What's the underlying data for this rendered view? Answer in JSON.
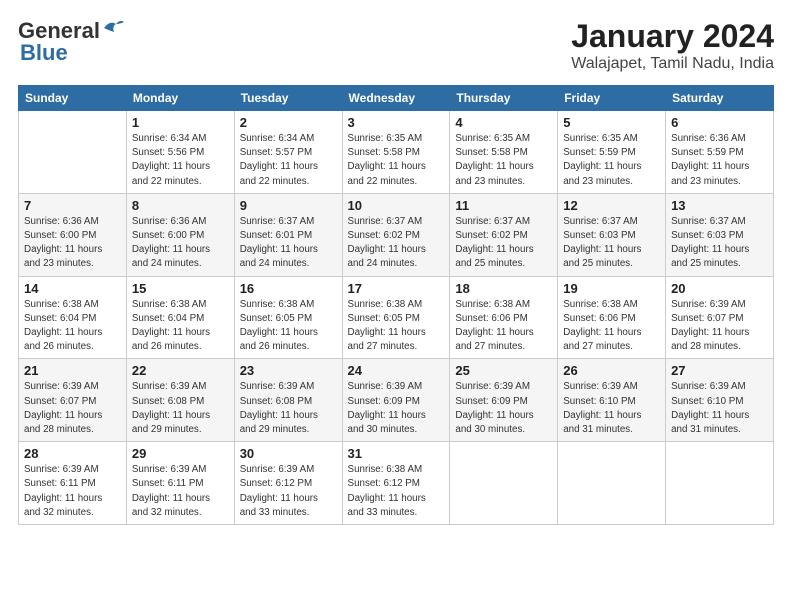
{
  "logo": {
    "line1": "General",
    "line2": "Blue"
  },
  "title": "January 2024",
  "subtitle": "Walajapet, Tamil Nadu, India",
  "days_of_week": [
    "Sunday",
    "Monday",
    "Tuesday",
    "Wednesday",
    "Thursday",
    "Friday",
    "Saturday"
  ],
  "weeks": [
    [
      {
        "num": "",
        "info": ""
      },
      {
        "num": "1",
        "info": "Sunrise: 6:34 AM\nSunset: 5:56 PM\nDaylight: 11 hours\nand 22 minutes."
      },
      {
        "num": "2",
        "info": "Sunrise: 6:34 AM\nSunset: 5:57 PM\nDaylight: 11 hours\nand 22 minutes."
      },
      {
        "num": "3",
        "info": "Sunrise: 6:35 AM\nSunset: 5:58 PM\nDaylight: 11 hours\nand 22 minutes."
      },
      {
        "num": "4",
        "info": "Sunrise: 6:35 AM\nSunset: 5:58 PM\nDaylight: 11 hours\nand 23 minutes."
      },
      {
        "num": "5",
        "info": "Sunrise: 6:35 AM\nSunset: 5:59 PM\nDaylight: 11 hours\nand 23 minutes."
      },
      {
        "num": "6",
        "info": "Sunrise: 6:36 AM\nSunset: 5:59 PM\nDaylight: 11 hours\nand 23 minutes."
      }
    ],
    [
      {
        "num": "7",
        "info": "Sunrise: 6:36 AM\nSunset: 6:00 PM\nDaylight: 11 hours\nand 23 minutes."
      },
      {
        "num": "8",
        "info": "Sunrise: 6:36 AM\nSunset: 6:00 PM\nDaylight: 11 hours\nand 24 minutes."
      },
      {
        "num": "9",
        "info": "Sunrise: 6:37 AM\nSunset: 6:01 PM\nDaylight: 11 hours\nand 24 minutes."
      },
      {
        "num": "10",
        "info": "Sunrise: 6:37 AM\nSunset: 6:02 PM\nDaylight: 11 hours\nand 24 minutes."
      },
      {
        "num": "11",
        "info": "Sunrise: 6:37 AM\nSunset: 6:02 PM\nDaylight: 11 hours\nand 25 minutes."
      },
      {
        "num": "12",
        "info": "Sunrise: 6:37 AM\nSunset: 6:03 PM\nDaylight: 11 hours\nand 25 minutes."
      },
      {
        "num": "13",
        "info": "Sunrise: 6:37 AM\nSunset: 6:03 PM\nDaylight: 11 hours\nand 25 minutes."
      }
    ],
    [
      {
        "num": "14",
        "info": "Sunrise: 6:38 AM\nSunset: 6:04 PM\nDaylight: 11 hours\nand 26 minutes."
      },
      {
        "num": "15",
        "info": "Sunrise: 6:38 AM\nSunset: 6:04 PM\nDaylight: 11 hours\nand 26 minutes."
      },
      {
        "num": "16",
        "info": "Sunrise: 6:38 AM\nSunset: 6:05 PM\nDaylight: 11 hours\nand 26 minutes."
      },
      {
        "num": "17",
        "info": "Sunrise: 6:38 AM\nSunset: 6:05 PM\nDaylight: 11 hours\nand 27 minutes."
      },
      {
        "num": "18",
        "info": "Sunrise: 6:38 AM\nSunset: 6:06 PM\nDaylight: 11 hours\nand 27 minutes."
      },
      {
        "num": "19",
        "info": "Sunrise: 6:38 AM\nSunset: 6:06 PM\nDaylight: 11 hours\nand 27 minutes."
      },
      {
        "num": "20",
        "info": "Sunrise: 6:39 AM\nSunset: 6:07 PM\nDaylight: 11 hours\nand 28 minutes."
      }
    ],
    [
      {
        "num": "21",
        "info": "Sunrise: 6:39 AM\nSunset: 6:07 PM\nDaylight: 11 hours\nand 28 minutes."
      },
      {
        "num": "22",
        "info": "Sunrise: 6:39 AM\nSunset: 6:08 PM\nDaylight: 11 hours\nand 29 minutes."
      },
      {
        "num": "23",
        "info": "Sunrise: 6:39 AM\nSunset: 6:08 PM\nDaylight: 11 hours\nand 29 minutes."
      },
      {
        "num": "24",
        "info": "Sunrise: 6:39 AM\nSunset: 6:09 PM\nDaylight: 11 hours\nand 30 minutes."
      },
      {
        "num": "25",
        "info": "Sunrise: 6:39 AM\nSunset: 6:09 PM\nDaylight: 11 hours\nand 30 minutes."
      },
      {
        "num": "26",
        "info": "Sunrise: 6:39 AM\nSunset: 6:10 PM\nDaylight: 11 hours\nand 31 minutes."
      },
      {
        "num": "27",
        "info": "Sunrise: 6:39 AM\nSunset: 6:10 PM\nDaylight: 11 hours\nand 31 minutes."
      }
    ],
    [
      {
        "num": "28",
        "info": "Sunrise: 6:39 AM\nSunset: 6:11 PM\nDaylight: 11 hours\nand 32 minutes."
      },
      {
        "num": "29",
        "info": "Sunrise: 6:39 AM\nSunset: 6:11 PM\nDaylight: 11 hours\nand 32 minutes."
      },
      {
        "num": "30",
        "info": "Sunrise: 6:39 AM\nSunset: 6:12 PM\nDaylight: 11 hours\nand 33 minutes."
      },
      {
        "num": "31",
        "info": "Sunrise: 6:38 AM\nSunset: 6:12 PM\nDaylight: 11 hours\nand 33 minutes."
      },
      {
        "num": "",
        "info": ""
      },
      {
        "num": "",
        "info": ""
      },
      {
        "num": "",
        "info": ""
      }
    ]
  ]
}
